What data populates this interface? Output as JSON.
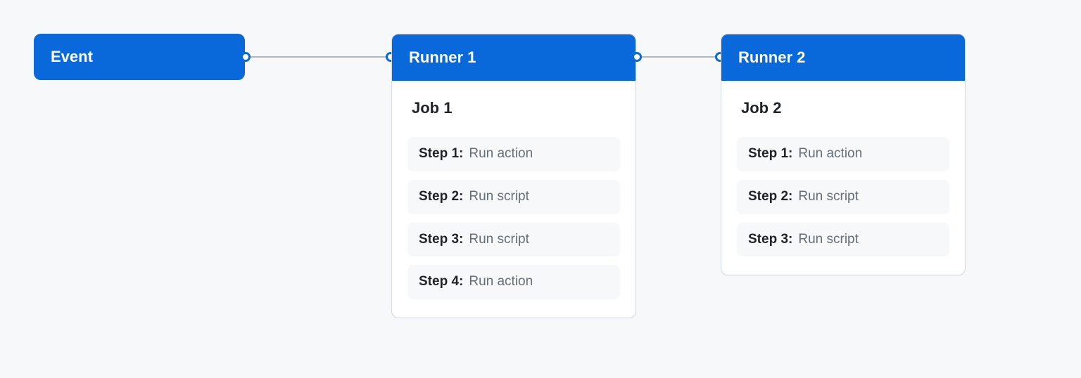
{
  "colors": {
    "accent": "#0969da",
    "page_bg": "#f6f8fa",
    "card_bg": "#ffffff",
    "border": "#d0d7de",
    "text": "#1f2328",
    "muted": "#656d76",
    "connector": "#afb8c1"
  },
  "event": {
    "label": "Event"
  },
  "runners": [
    {
      "title": "Runner 1",
      "job_title": "Job 1",
      "steps": [
        {
          "label": "Step 1:",
          "desc": "Run action"
        },
        {
          "label": "Step 2:",
          "desc": "Run script"
        },
        {
          "label": "Step 3:",
          "desc": "Run script"
        },
        {
          "label": "Step 4:",
          "desc": "Run action"
        }
      ]
    },
    {
      "title": "Runner 2",
      "job_title": "Job 2",
      "steps": [
        {
          "label": "Step 1:",
          "desc": "Run action"
        },
        {
          "label": "Step 2:",
          "desc": "Run script"
        },
        {
          "label": "Step 3:",
          "desc": "Run script"
        }
      ]
    }
  ]
}
